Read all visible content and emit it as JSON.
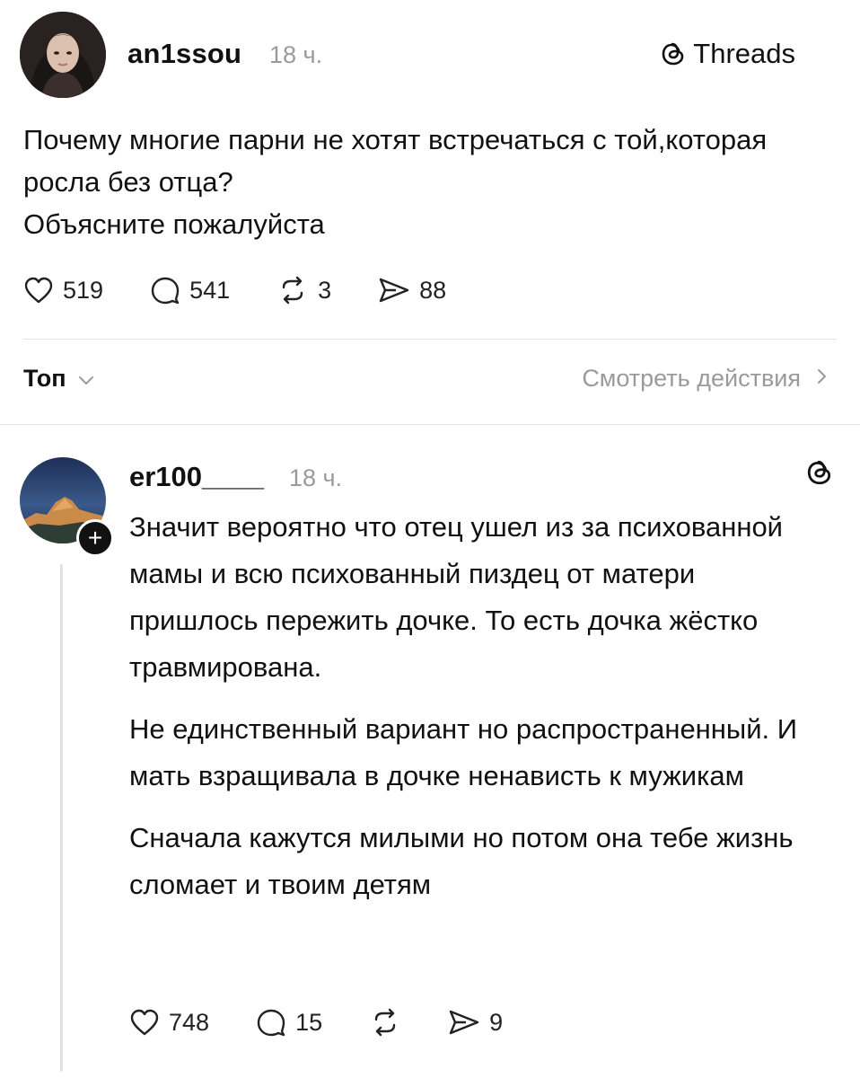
{
  "post": {
    "username": "an1ssou",
    "time": "18 ч.",
    "brand": "Threads",
    "paragraphs": [
      "Почему многие парни не хотят встречаться с той,которая росла без отца?",
      "Объясните пожалуйста"
    ],
    "stats": {
      "likes": "519",
      "comments": "541",
      "reposts": "3",
      "shares": "88"
    }
  },
  "sort": {
    "label": "Топ",
    "view_activity": "Смотреть действия"
  },
  "reply": {
    "username": "er100____",
    "time": "18 ч.",
    "follow_symbol": "+",
    "paragraphs": [
      "Значит вероятно что отец ушел из за психованной мамы и всю психованный пиздец от матери пришлось пережить дочке. То есть дочка жёстко травмирована.",
      "Не единственный вариант но распространенный. И мать взращивала в дочке ненависть к мужикам",
      "Сначала кажутся милыми но потом она тебе жизнь сломает и твоим детям"
    ],
    "stats": {
      "likes": "748",
      "comments": "15",
      "shares": "9"
    }
  },
  "icons": {
    "like": "heart-icon",
    "comment": "speech-bubble-icon",
    "repost": "repost-arrows-icon",
    "share": "send-icon",
    "brand": "threads-logo-icon",
    "sort": "chevron-down-icon",
    "view": "chevron-right-icon"
  }
}
